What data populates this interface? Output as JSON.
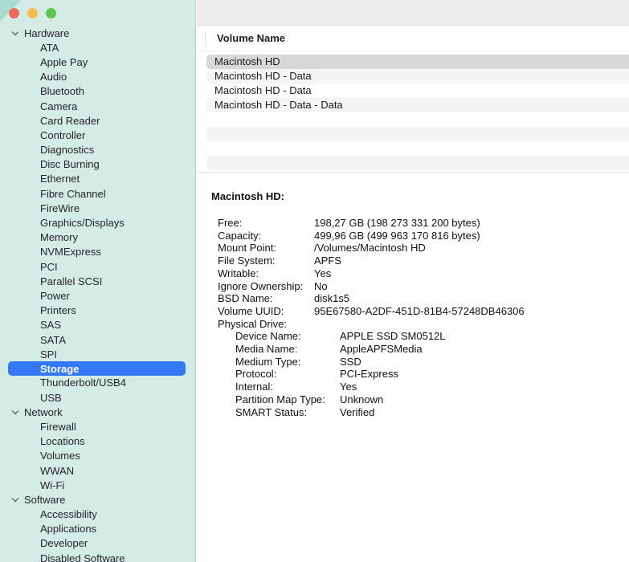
{
  "window_controls": {
    "close": "close",
    "minimize": "minimize",
    "zoom": "zoom"
  },
  "sidebar": {
    "selected_item": "Storage",
    "sections": [
      {
        "label": "Hardware",
        "items": [
          "ATA",
          "Apple Pay",
          "Audio",
          "Bluetooth",
          "Camera",
          "Card Reader",
          "Controller",
          "Diagnostics",
          "Disc Burning",
          "Ethernet",
          "Fibre Channel",
          "FireWire",
          "Graphics/Displays",
          "Memory",
          "NVMExpress",
          "PCI",
          "Parallel SCSI",
          "Power",
          "Printers",
          "SAS",
          "SATA",
          "SPI",
          "Storage",
          "Thunderbolt/USB4",
          "USB"
        ]
      },
      {
        "label": "Network",
        "items": [
          "Firewall",
          "Locations",
          "Volumes",
          "WWAN",
          "Wi-Fi"
        ]
      },
      {
        "label": "Software",
        "items": [
          "Accessibility",
          "Applications",
          "Developer",
          "Disabled Software"
        ]
      }
    ]
  },
  "volumes_table": {
    "column_header": "Volume Name",
    "rows": [
      "Macintosh HD",
      "Macintosh HD - Data",
      "Macintosh HD - Data",
      "Macintosh HD - Data - Data"
    ],
    "selected_row": "Macintosh HD"
  },
  "details": {
    "title": "Macintosh HD:",
    "fields": [
      {
        "label": "Free:",
        "value": "198,27 GB (198 273 331 200 bytes)",
        "indent": 0
      },
      {
        "label": "Capacity:",
        "value": "499,96 GB (499 963 170 816 bytes)",
        "indent": 0
      },
      {
        "label": "Mount Point:",
        "value": "/Volumes/Macintosh HD",
        "indent": 0
      },
      {
        "label": "File System:",
        "value": "APFS",
        "indent": 0
      },
      {
        "label": "Writable:",
        "value": "Yes",
        "indent": 0
      },
      {
        "label": "Ignore Ownership:",
        "value": "No",
        "indent": 0
      },
      {
        "label": "BSD Name:",
        "value": "disk1s5",
        "indent": 0
      },
      {
        "label": "Volume UUID:",
        "value": "95E67580-A2DF-451D-81B4-57248DB46306",
        "indent": 0
      },
      {
        "label": "Physical Drive:",
        "value": "",
        "indent": 0
      },
      {
        "label": "Device Name:",
        "value": "APPLE SSD SM0512L",
        "indent": 1
      },
      {
        "label": "Media Name:",
        "value": "AppleAPFSMedia",
        "indent": 1
      },
      {
        "label": "Medium Type:",
        "value": "SSD",
        "indent": 1
      },
      {
        "label": "Protocol:",
        "value": "PCI-Express",
        "indent": 1
      },
      {
        "label": "Internal:",
        "value": "Yes",
        "indent": 1
      },
      {
        "label": "Partition Map Type:",
        "value": "Unknown",
        "indent": 1
      },
      {
        "label": "SMART Status:",
        "value": "Verified",
        "indent": 1
      }
    ]
  },
  "colors": {
    "accent_selection_blue": "#3478f6",
    "sidebar_background": "#d5ebe6",
    "table_row_selected_gray": "#d8d8d8",
    "table_row_stripe": "#f5f5f5",
    "toolbar_background": "#ededed",
    "traffic_close": "#ee6a5f",
    "traffic_minimize": "#f5bd4f",
    "traffic_zoom": "#61c554"
  }
}
